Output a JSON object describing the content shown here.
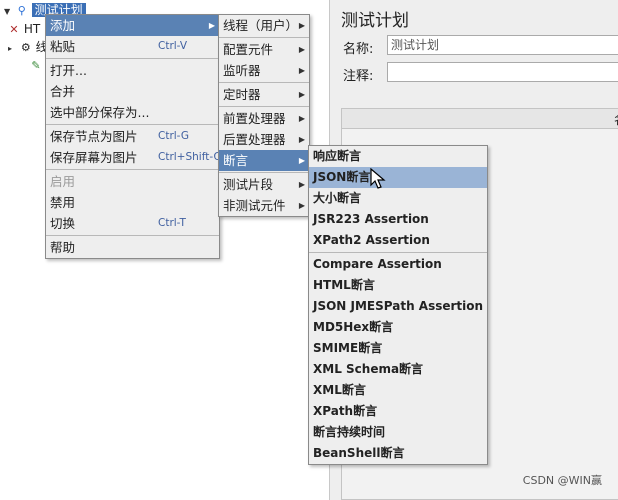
{
  "tree": {
    "root_label": "测试计划",
    "child1_label": "HT",
    "child2_label": "线"
  },
  "panel": {
    "title": "测试计划",
    "name_label": "名称:",
    "name_value": "测试计划",
    "comment_label": "注释:",
    "comment_value": "",
    "table_column": "名"
  },
  "context_menu": {
    "add": "添加",
    "paste": "粘贴",
    "paste_shortcut": "Ctrl-V",
    "open": "打开...",
    "merge": "合并",
    "save_selection": "选中部分保存为...",
    "save_node_image": "保存节点为图片",
    "save_node_image_shortcut": "Ctrl-G",
    "save_screen_image": "保存屏幕为图片",
    "save_screen_image_shortcut": "Ctrl+Shift-G",
    "enable": "启用",
    "disable": "禁用",
    "toggle": "切换",
    "toggle_shortcut": "Ctrl-T",
    "help": "帮助"
  },
  "add_menu": {
    "threads": "线程（用户）",
    "config": "配置元件",
    "listener": "监听器",
    "timer": "定时器",
    "pre_processor": "前置处理器",
    "post_processor": "后置处理器",
    "assertion": "断言",
    "test_fragment": "测试片段",
    "non_test": "非测试元件"
  },
  "assertion_menu": {
    "response": "响应断言",
    "json": "JSON断言",
    "size": "大小断言",
    "jsr223": "JSR223 Assertion",
    "xpath2": "XPath2 Assertion",
    "compare": "Compare Assertion",
    "html": "HTML断言",
    "jmespath": "JSON JMESPath Assertion",
    "md5hex": "MD5Hex断言",
    "smime": "SMIME断言",
    "xml_schema": "XML Schema断言",
    "xml": "XML断言",
    "xpath": "XPath断言",
    "duration": "断言持续时间",
    "beanshell": "BeanShell断言"
  },
  "watermark": "CSDN @WIN赢"
}
